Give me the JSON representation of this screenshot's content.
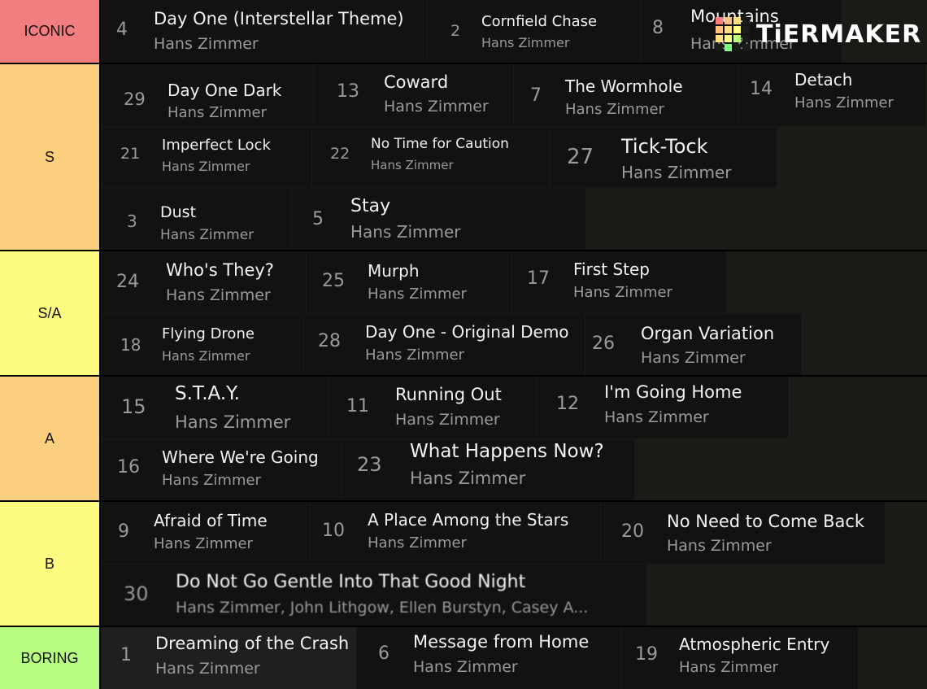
{
  "watermark": {
    "text": "TiERMAKER"
  },
  "colors": {
    "iconic": "#f27d7f",
    "s": "#fccf7e",
    "sa": "#fdfc80",
    "a": "#fccf7e",
    "b": "#fdfc80",
    "boring": "#b7fc7e"
  },
  "tiers": [
    {
      "label": "ICONIC",
      "songs": [
        {
          "num": "4",
          "title": "Day One (Interstellar Theme)",
          "artist": "Hans Zimmer"
        },
        {
          "num": "2",
          "title": "Cornfield Chase",
          "artist": "Hans Zimmer"
        },
        {
          "num": "8",
          "title": "Mountains",
          "artist": "Hans Zimmer"
        }
      ]
    },
    {
      "label": "S",
      "songs": [
        {
          "num": "29",
          "title": "Day One Dark",
          "artist": "Hans Zimmer"
        },
        {
          "num": "13",
          "title": "Coward",
          "artist": "Hans Zimmer"
        },
        {
          "num": "7",
          "title": "The Wormhole",
          "artist": "Hans Zimmer"
        },
        {
          "num": "14",
          "title": "Detach",
          "artist": "Hans Zimmer"
        },
        {
          "num": "21",
          "title": "Imperfect Lock",
          "artist": "Hans Zimmer"
        },
        {
          "num": "22",
          "title": "No Time for Caution",
          "artist": "Hans Zimmer"
        },
        {
          "num": "27",
          "title": "Tick-Tock",
          "artist": "Hans Zimmer"
        },
        {
          "num": "3",
          "title": "Dust",
          "artist": "Hans Zimmer"
        },
        {
          "num": "5",
          "title": "Stay",
          "artist": "Hans Zimmer"
        }
      ]
    },
    {
      "label": "S/A",
      "songs": [
        {
          "num": "24",
          "title": "Who's They?",
          "artist": "Hans Zimmer"
        },
        {
          "num": "25",
          "title": "Murph",
          "artist": "Hans Zimmer"
        },
        {
          "num": "17",
          "title": "First Step",
          "artist": "Hans Zimmer"
        },
        {
          "num": "18",
          "title": "Flying Drone",
          "artist": "Hans Zimmer"
        },
        {
          "num": "28",
          "title": "Day One - Original Demo",
          "artist": "Hans Zimmer"
        },
        {
          "num": "26",
          "title": "Organ Variation",
          "artist": "Hans Zimmer"
        }
      ]
    },
    {
      "label": "A",
      "songs": [
        {
          "num": "15",
          "title": "S.T.A.Y.",
          "artist": "Hans Zimmer"
        },
        {
          "num": "11",
          "title": "Running Out",
          "artist": "Hans Zimmer"
        },
        {
          "num": "12",
          "title": "I'm Going Home",
          "artist": "Hans Zimmer"
        },
        {
          "num": "16",
          "title": "Where We're Going",
          "artist": "Hans Zimmer"
        },
        {
          "num": "23",
          "title": "What Happens Now?",
          "artist": "Hans Zimmer"
        }
      ]
    },
    {
      "label": "B",
      "songs": [
        {
          "num": "9",
          "title": "Afraid of Time",
          "artist": "Hans Zimmer"
        },
        {
          "num": "10",
          "title": "A Place Among the Stars",
          "artist": "Hans Zimmer"
        },
        {
          "num": "20",
          "title": "No Need to Come Back",
          "artist": "Hans Zimmer"
        },
        {
          "num": "30",
          "title": "Do Not Go Gentle Into That Good Night",
          "artist": "Hans Zimmer, John Lithgow, Ellen Burstyn, Casey A..."
        }
      ]
    },
    {
      "label": "BORING",
      "songs": [
        {
          "num": "1",
          "title": "Dreaming of the Crash",
          "artist": "Hans Zimmer"
        },
        {
          "num": "6",
          "title": "Message from Home",
          "artist": "Hans Zimmer"
        },
        {
          "num": "19",
          "title": "Atmospheric Entry",
          "artist": "Hans Zimmer"
        }
      ]
    }
  ]
}
